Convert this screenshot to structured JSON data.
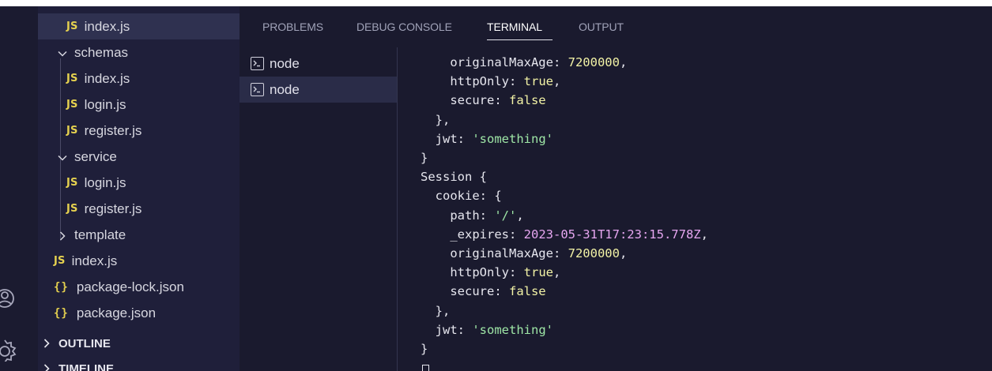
{
  "explorer": {
    "items": [
      {
        "label": "index.js",
        "type": "js",
        "selected": true
      },
      {
        "label": "schemas",
        "type": "folder-open"
      },
      {
        "label": "index.js",
        "type": "js"
      },
      {
        "label": "login.js",
        "type": "js"
      },
      {
        "label": "register.js",
        "type": "js"
      },
      {
        "label": "service",
        "type": "folder-open"
      },
      {
        "label": "login.js",
        "type": "js"
      },
      {
        "label": "register.js",
        "type": "js"
      },
      {
        "label": "template",
        "type": "folder-closed"
      },
      {
        "label": "index.js",
        "type": "js"
      },
      {
        "label": "package-lock.json",
        "type": "json"
      },
      {
        "label": "package.json",
        "type": "json"
      }
    ],
    "badges": {
      "js": "JS",
      "json": "{}"
    },
    "sections": {
      "outline": "OUTLINE",
      "timeline": "TIMELINE"
    }
  },
  "panel": {
    "tabs": [
      "PROBLEMS",
      "DEBUG CONSOLE",
      "TERMINAL",
      "OUTPUT"
    ],
    "active_tab": "TERMINAL"
  },
  "terminals": [
    {
      "label": "node",
      "selected": false
    },
    {
      "label": "node",
      "selected": true
    }
  ],
  "terminal_output": {
    "lines": [
      "    originalMaxAge: 7200000,",
      "    httpOnly: true,",
      "    secure: false",
      "  },",
      "  jwt: 'something'",
      "}",
      "Session {",
      "  cookie: {",
      "    path: '/',",
      "    _expires: 2023-05-31T17:23:15.778Z,",
      "    originalMaxAge: 7200000,",
      "    httpOnly: true,",
      "    secure: false",
      "  },",
      "  jwt: 'something'",
      "}"
    ]
  },
  "colors": {
    "background": "#1a1a2e",
    "sidebar": "#1f1f3a",
    "js_badge": "#e5d14f",
    "number": "#f3f3a6",
    "string": "#9ee6a6",
    "date": "#e6a6f0"
  }
}
